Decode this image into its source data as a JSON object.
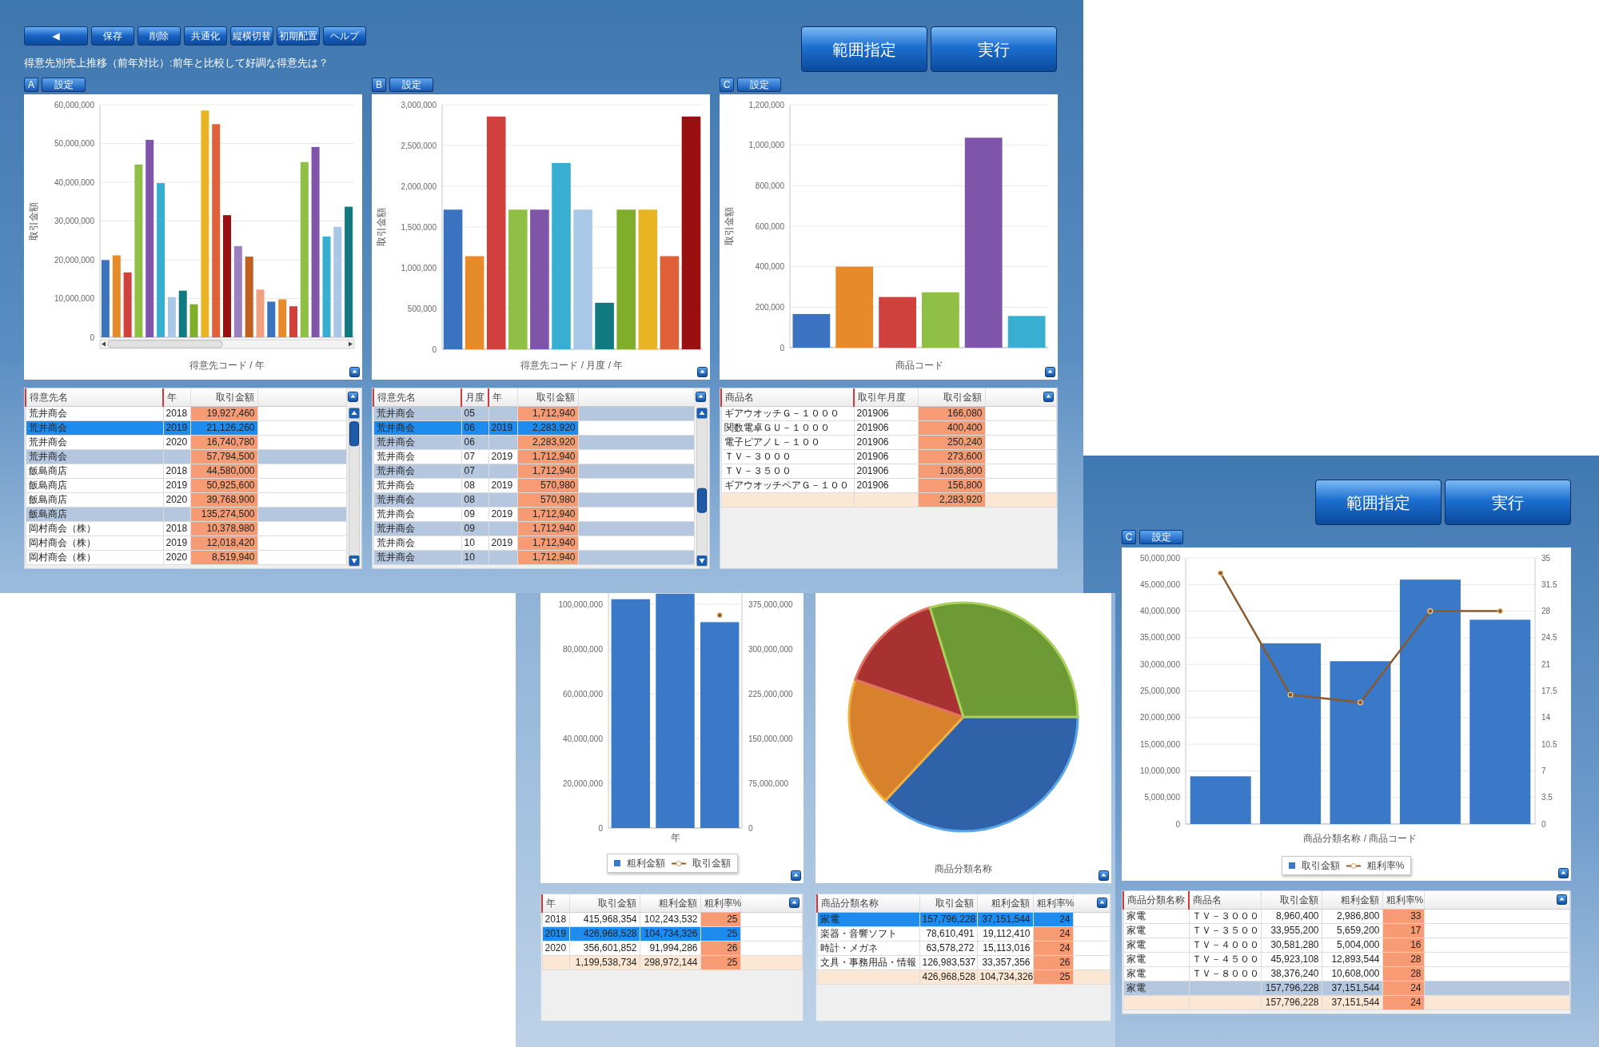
{
  "screen_1": {
    "toolbar": [
      "◀",
      "保存",
      "削除",
      "共通化",
      "縦横切替",
      "初期配置",
      "ヘルプ"
    ],
    "title": "得意先別売上推移（前年対比）:前年と比較して好調な得意先は？",
    "action_buttons": [
      "範囲指定",
      "実行"
    ],
    "panels": [
      {
        "kind": "bar_chart",
        "tab": "A",
        "settings": "設定",
        "chart_scrollbar": true,
        "chart_data": {
          "type": "bar",
          "xlabel": "得意先コード / 年",
          "ylabel": "取引金額",
          "grid": true,
          "ylim": [
            0,
            60000000
          ],
          "yticks": [
            {
              "value": 0,
              "label": "0"
            },
            {
              "value": 10000000,
              "label": "10,000,000"
            },
            {
              "value": 20000000,
              "label": "20,000,000"
            },
            {
              "value": 30000000,
              "label": "30,000,000"
            },
            {
              "value": 40000000,
              "label": "40,000,000"
            },
            {
              "value": 50000000,
              "label": "50,000,000"
            },
            {
              "value": 60000000,
              "label": "60,000,000"
            }
          ],
          "series": [
            {
              "type": "bar",
              "values": [
                19927460,
                21126260,
                16740780,
                44580000,
                50925600,
                39768900,
                10378980,
                12018420,
                8519940,
                58500000,
                55000000,
                31500000,
                23500000,
                20800000,
                12300000,
                9200000,
                9800000,
                8000000,
                45200000,
                49100000,
                26000000,
                28500000,
                33700000
              ]
            }
          ]
        },
        "table": {
          "scrollbar": true,
          "columns": [
            {
              "label": "得意先名",
              "grouped": true,
              "kind": "text",
              "highlight": false
            },
            {
              "label": "年",
              "grouped": true,
              "kind": "text",
              "highlight": false
            },
            {
              "label": "取引金額",
              "grouped": false,
              "kind": "number",
              "highlight": true
            }
          ],
          "rows": [
            {
              "kind": "detail",
              "selected": false,
              "cells": [
                "荒井商会",
                "2018",
                "19,927,460"
              ]
            },
            {
              "kind": "detail",
              "selected": true,
              "cells": [
                "荒井商会",
                "2019",
                "21,126,260"
              ]
            },
            {
              "kind": "detail",
              "selected": false,
              "cells": [
                "荒井商会",
                "2020",
                "16,740,780"
              ]
            },
            {
              "kind": "subtotal",
              "selected": false,
              "cells": [
                "荒井商会",
                null,
                "57,794,500"
              ]
            },
            {
              "kind": "detail",
              "selected": false,
              "cells": [
                "飯島商店",
                "2018",
                "44,580,000"
              ]
            },
            {
              "kind": "detail",
              "selected": false,
              "cells": [
                "飯島商店",
                "2019",
                "50,925,600"
              ]
            },
            {
              "kind": "detail",
              "selected": false,
              "cells": [
                "飯島商店",
                "2020",
                "39,768,900"
              ]
            },
            {
              "kind": "subtotal",
              "selected": false,
              "cells": [
                "飯島商店",
                null,
                "135,274,500"
              ]
            },
            {
              "kind": "detail",
              "selected": false,
              "cells": [
                "岡村商会（株）",
                "2018",
                "10,378,980"
              ]
            },
            {
              "kind": "detail",
              "selected": false,
              "cells": [
                "岡村商会（株）",
                "2019",
                "12,018,420"
              ]
            },
            {
              "kind": "detail",
              "selected": false,
              "cells": [
                "岡村商会（株）",
                "2020",
                "8,519,940"
              ]
            }
          ]
        }
      },
      {
        "kind": "bar_chart",
        "tab": "B",
        "settings": "設定",
        "chart_scrollbar": false,
        "chart_data": {
          "type": "bar",
          "xlabel": "得意先コード / 月度 / 年",
          "ylabel": "取引金額",
          "grid": true,
          "ylim": [
            0,
            3000000
          ],
          "yticks": [
            {
              "value": 0,
              "label": "0"
            },
            {
              "value": 500000,
              "label": "500,000"
            },
            {
              "value": 1000000,
              "label": "1,000,000"
            },
            {
              "value": 1500000,
              "label": "1,500,000"
            },
            {
              "value": 2000000,
              "label": "2,000,000"
            },
            {
              "value": 2500000,
              "label": "2,500,000"
            },
            {
              "value": 3000000,
              "label": "3,000,000"
            }
          ],
          "series": [
            {
              "type": "bar",
              "values": [
                1712940,
                1141960,
                2854900,
                1712940,
                1712940,
                2283920,
                1712940,
                570980,
                1712940,
                1712940,
                1141960,
                2854900
              ]
            }
          ]
        },
        "table": {
          "scrollbar": true,
          "columns": [
            {
              "label": "得意先名",
              "grouped": true,
              "kind": "text",
              "highlight": false
            },
            {
              "label": "月度",
              "grouped": true,
              "kind": "text",
              "highlight": false
            },
            {
              "label": "年",
              "grouped": true,
              "kind": "text",
              "highlight": false
            },
            {
              "label": "取引金額",
              "grouped": false,
              "kind": "number",
              "highlight": true
            }
          ],
          "rows": [
            {
              "kind": "subtotal",
              "selected": false,
              "cells": [
                "荒井商会",
                "05",
                null,
                "1,712,940"
              ]
            },
            {
              "kind": "detail",
              "selected": true,
              "cells": [
                "荒井商会",
                "06",
                "2019",
                "2,283,920"
              ]
            },
            {
              "kind": "subtotal",
              "selected": false,
              "cells": [
                "荒井商会",
                "06",
                null,
                "2,283,920"
              ]
            },
            {
              "kind": "detail",
              "selected": false,
              "cells": [
                "荒井商会",
                "07",
                "2019",
                "1,712,940"
              ]
            },
            {
              "kind": "subtotal",
              "selected": false,
              "cells": [
                "荒井商会",
                "07",
                null,
                "1,712,940"
              ]
            },
            {
              "kind": "detail",
              "selected": false,
              "cells": [
                "荒井商会",
                "08",
                "2019",
                "570,980"
              ]
            },
            {
              "kind": "subtotal",
              "selected": false,
              "cells": [
                "荒井商会",
                "08",
                null,
                "570,980"
              ]
            },
            {
              "kind": "detail",
              "selected": false,
              "cells": [
                "荒井商会",
                "09",
                "2019",
                "1,712,940"
              ]
            },
            {
              "kind": "subtotal",
              "selected": false,
              "cells": [
                "荒井商会",
                "09",
                null,
                "1,712,940"
              ]
            },
            {
              "kind": "detail",
              "selected": false,
              "cells": [
                "荒井商会",
                "10",
                "2019",
                "1,712,940"
              ]
            },
            {
              "kind": "subtotal",
              "selected": false,
              "cells": [
                "荒井商会",
                "10",
                null,
                "1,712,940"
              ]
            }
          ]
        }
      },
      {
        "kind": "bar_chart",
        "tab": "C",
        "settings": "設定",
        "chart_scrollbar": false,
        "chart_data": {
          "type": "bar",
          "xlabel": "商品コード",
          "ylabel": "取引金額",
          "grid": true,
          "ylim": [
            0,
            1200000
          ],
          "yticks": [
            {
              "value": 0,
              "label": "0"
            },
            {
              "value": 200000,
              "label": "200,000"
            },
            {
              "value": 400000,
              "label": "400,000"
            },
            {
              "value": 600000,
              "label": "600,000"
            },
            {
              "value": 800000,
              "label": "800,000"
            },
            {
              "value": 1000000,
              "label": "1,000,000"
            },
            {
              "value": 1200000,
              "label": "1,200,000"
            }
          ],
          "series": [
            {
              "type": "bar",
              "values": [
                166080,
                400400,
                250240,
                273600,
                1036800,
                156800
              ]
            }
          ]
        },
        "table": {
          "scrollbar": false,
          "columns": [
            {
              "label": "商品名",
              "grouped": true,
              "kind": "text",
              "highlight": false
            },
            {
              "label": "取引年月度",
              "grouped": true,
              "kind": "text",
              "highlight": false
            },
            {
              "label": "取引金額",
              "grouped": false,
              "kind": "number",
              "highlight": true
            }
          ],
          "rows": [
            {
              "kind": "detail",
              "selected": false,
              "cells": [
                "ギアウオッチＧ－１０００",
                "201906",
                "166,080"
              ]
            },
            {
              "kind": "detail",
              "selected": false,
              "cells": [
                "関数電卓ＧＵ－１０００",
                "201906",
                "400,400"
              ]
            },
            {
              "kind": "detail",
              "selected": false,
              "cells": [
                "電子ピアノＬ－１００",
                "201906",
                "250,240"
              ]
            },
            {
              "kind": "detail",
              "selected": false,
              "cells": [
                "ＴＶ－３０００",
                "201906",
                "273,600"
              ]
            },
            {
              "kind": "detail",
              "selected": false,
              "cells": [
                "ＴＶ－３５００",
                "201906",
                "1,036,800"
              ]
            },
            {
              "kind": "detail",
              "selected": false,
              "cells": [
                "ギアウオッチペアＧ－１００",
                "201906",
                "156,800"
              ]
            },
            {
              "kind": "total",
              "selected": false,
              "cells": [
                null,
                null,
                "2,283,920"
              ]
            }
          ]
        }
      }
    ]
  },
  "screen_2": {
    "panels": [
      {
        "kind": "bar_chart",
        "chart_data": {
          "type": "bar",
          "xlabel": "年",
          "grid": true,
          "ylim": [
            0,
            105000000
          ],
          "yticks": [
            {
              "value": 0,
              "label": "0"
            },
            {
              "value": 20000000,
              "label": "20,000,000"
            },
            {
              "value": 40000000,
              "label": "40,000,000"
            },
            {
              "value": 60000000,
              "label": "60,000,000"
            },
            {
              "value": 80000000,
              "label": "80,000,000"
            },
            {
              "value": 100000000,
              "label": "100,000,000"
            }
          ],
          "y2lim": [
            0,
            393750000
          ],
          "y2ticks": [
            {
              "value": 0,
              "label": "0"
            },
            {
              "value": 75000000,
              "label": "75,000,000"
            },
            {
              "value": 150000000,
              "label": "150,000,000"
            },
            {
              "value": 225000000,
              "label": "225,000,000"
            },
            {
              "value": 300000000,
              "label": "300,000,000"
            },
            {
              "value": 375000000,
              "label": "375,000,000"
            }
          ],
          "series": [
            {
              "name": "粗利金額",
              "type": "bar",
              "color": "#3a78c8",
              "values": [
                102243532,
                104734326,
                91994286
              ]
            },
            {
              "name": "取引金額",
              "type": "line",
              "axis": "y2",
              "color": "#8b5a2b",
              "marker": true,
              "values": [
                null,
                null,
                356601852
              ]
            }
          ]
        },
        "table": {
          "scrollbar": false,
          "columns": [
            {
              "label": "年",
              "grouped": true,
              "kind": "text",
              "highlight": false
            },
            {
              "label": "取引金額",
              "grouped": false,
              "kind": "number",
              "highlight": false
            },
            {
              "label": "粗利金額",
              "grouped": false,
              "kind": "number",
              "highlight": false
            },
            {
              "label": "粗利率%",
              "grouped": false,
              "kind": "number",
              "highlight": true
            }
          ],
          "rows": [
            {
              "kind": "detail",
              "selected": false,
              "cells": [
                "2018",
                "415,968,354",
                "102,243,532",
                "25"
              ]
            },
            {
              "kind": "detail",
              "selected": true,
              "cells": [
                "2019",
                "426,968,528",
                "104,734,326",
                "25"
              ]
            },
            {
              "kind": "detail",
              "selected": false,
              "cells": [
                "2020",
                "356,601,852",
                "91,994,286",
                "26"
              ]
            },
            {
              "kind": "total",
              "selected": false,
              "cells": [
                null,
                "1,199,538,734",
                "298,972,144",
                "25"
              ]
            }
          ]
        }
      },
      {
        "kind": "pie_chart",
        "pie": {
          "title": "商品分類名称"
        },
        "table": {
          "scrollbar": false,
          "columns": [
            {
              "label": "商品分類名称",
              "grouped": true,
              "kind": "text",
              "highlight": false
            },
            {
              "label": "取引金額",
              "grouped": false,
              "kind": "number",
              "highlight": false
            },
            {
              "label": "粗利金額",
              "grouped": false,
              "kind": "number",
              "highlight": false
            },
            {
              "label": "粗利率%",
              "grouped": false,
              "kind": "number",
              "highlight": true
            }
          ],
          "rows": [
            {
              "kind": "detail",
              "selected": true,
              "cells": [
                "家電",
                "157,796,228",
                "37,151,544",
                "24"
              ]
            },
            {
              "kind": "detail",
              "selected": false,
              "cells": [
                "楽器・音響ソフト",
                "78,610,491",
                "19,112,410",
                "24"
              ]
            },
            {
              "kind": "detail",
              "selected": false,
              "cells": [
                "時計・メガネ",
                "63,578,272",
                "15,113,016",
                "24"
              ]
            },
            {
              "kind": "detail",
              "selected": false,
              "cells": [
                "文具・事務用品・情報",
                "126,983,537",
                "33,357,356",
                "26"
              ]
            },
            {
              "kind": "total",
              "selected": false,
              "cells": [
                null,
                "426,968,528",
                "104,734,326",
                "25"
              ]
            }
          ]
        }
      }
    ]
  },
  "screen_3": {
    "action_buttons": [
      "範囲指定",
      "実行"
    ],
    "panels": [
      {
        "kind": "bar_chart",
        "tab": "C",
        "settings": "設定",
        "chart_scrollbar": false,
        "chart_data": {
          "type": "bar",
          "xlabel": "商品分類名称 / 商品コード",
          "grid": true,
          "ylim": [
            0,
            50000000
          ],
          "yticks": [
            {
              "value": 0,
              "label": "0"
            },
            {
              "value": 5000000,
              "label": "5,000,000"
            },
            {
              "value": 10000000,
              "label": "10,000,000"
            },
            {
              "value": 15000000,
              "label": "15,000,000"
            },
            {
              "value": 20000000,
              "label": "20,000,000"
            },
            {
              "value": 25000000,
              "label": "25,000,000"
            },
            {
              "value": 30000000,
              "label": "30,000,000"
            },
            {
              "value": 35000000,
              "label": "35,000,000"
            },
            {
              "value": 40000000,
              "label": "40,000,000"
            },
            {
              "value": 45000000,
              "label": "45,000,000"
            },
            {
              "value": 50000000,
              "label": "50,000,000"
            }
          ],
          "y2lim": [
            0,
            35
          ],
          "y2ticks": [
            {
              "value": 0,
              "label": "0"
            },
            3.5,
            7,
            10.5,
            14,
            17.5,
            21,
            24.5,
            28,
            31.5,
            35
          ],
          "series": [
            {
              "name": "取引金額",
              "type": "bar",
              "color": "#3a78c8",
              "values": [
                8960400,
                33955200,
                30581280,
                45923108,
                38376240
              ]
            },
            {
              "name": "粗利率%",
              "type": "line",
              "axis": "y2",
              "color": "#8b5a2b",
              "marker": true,
              "values": [
                33,
                17,
                16,
                28,
                28
              ]
            }
          ]
        },
        "table": {
          "scrollbar": false,
          "columns": [
            {
              "label": "商品分類名称",
              "grouped": true,
              "kind": "text",
              "highlight": false
            },
            {
              "label": "商品名",
              "grouped": true,
              "kind": "text",
              "highlight": false
            },
            {
              "label": "取引金額",
              "grouped": false,
              "kind": "number",
              "highlight": false
            },
            {
              "label": "粗利金額",
              "grouped": false,
              "kind": "number",
              "highlight": false
            },
            {
              "label": "粗利率%",
              "grouped": false,
              "kind": "number",
              "highlight": true
            }
          ],
          "rows": [
            {
              "kind": "detail",
              "selected": false,
              "cells": [
                "家電",
                "ＴＶ－３０００",
                "8,960,400",
                "2,986,800",
                "33"
              ]
            },
            {
              "kind": "detail",
              "selected": false,
              "cells": [
                "家電",
                "ＴＶ－３５００",
                "33,955,200",
                "5,659,200",
                "17"
              ]
            },
            {
              "kind": "detail",
              "selected": false,
              "cells": [
                "家電",
                "ＴＶ－４０００",
                "30,581,280",
                "5,004,000",
                "16"
              ]
            },
            {
              "kind": "detail",
              "selected": false,
              "cells": [
                "家電",
                "ＴＶ－４５００",
                "45,923,108",
                "12,893,544",
                "28"
              ]
            },
            {
              "kind": "detail",
              "selected": false,
              "cells": [
                "家電",
                "ＴＶ－８０００",
                "38,376,240",
                "10,608,000",
                "28"
              ]
            },
            {
              "kind": "subtotal",
              "selected": false,
              "cells": [
                "家電",
                null,
                "157,796,228",
                "37,151,544",
                "24"
              ]
            },
            {
              "kind": "total",
              "selected": false,
              "cells": [
                null,
                null,
                "157,796,228",
                "37,151,544",
                "24"
              ]
            }
          ]
        }
      }
    ]
  }
}
